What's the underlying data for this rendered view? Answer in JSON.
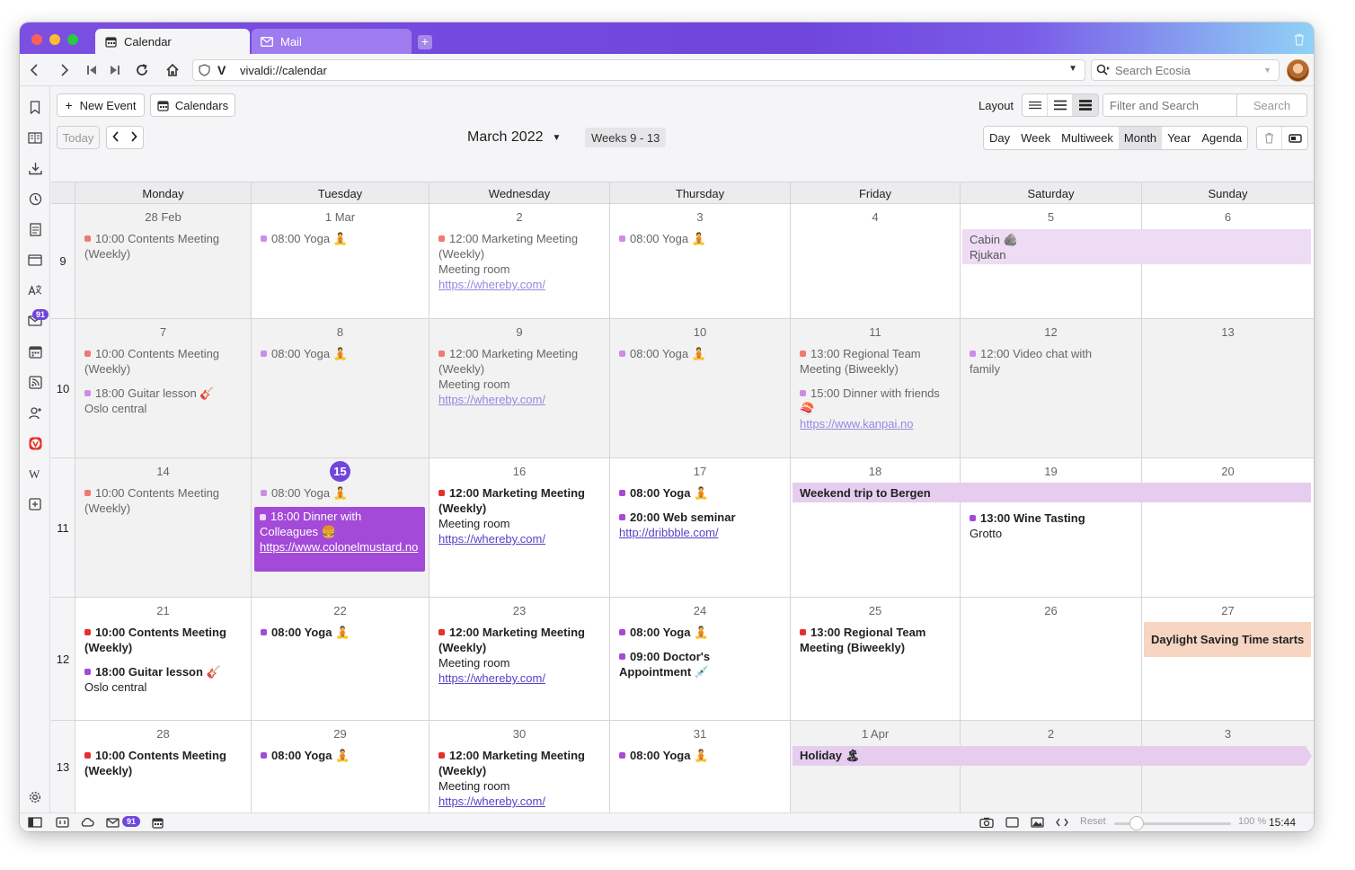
{
  "tabs": [
    {
      "label": "Calendar",
      "icon": "calendar-icon",
      "active": true
    },
    {
      "label": "Mail",
      "icon": "mail-icon",
      "active": false
    }
  ],
  "address": {
    "url": "vivaldi://calendar",
    "search_placeholder": "Search Ecosia"
  },
  "toolbar": {
    "new_event": "New Event",
    "calendars": "Calendars",
    "today": "Today",
    "layout_label": "Layout",
    "filter_placeholder": "Filter and Search",
    "search_button": "Search",
    "title": "March 2022",
    "weeks": "Weeks 9 - 13",
    "views": [
      "Day",
      "Week",
      "Multiweek",
      "Month",
      "Year",
      "Agenda"
    ],
    "active_view": "Month"
  },
  "weekdays": [
    "Monday",
    "Tuesday",
    "Wednesday",
    "Thursday",
    "Friday",
    "Saturday",
    "Sunday"
  ],
  "week_numbers": [
    "9",
    "10",
    "11",
    "12",
    "13"
  ],
  "days": [
    [
      "28 Feb",
      "1 Mar",
      "2",
      "3",
      "4",
      "5",
      "6"
    ],
    [
      "7",
      "8",
      "9",
      "10",
      "11",
      "12",
      "13"
    ],
    [
      "14",
      "15",
      "16",
      "17",
      "18",
      "19",
      "20"
    ],
    [
      "21",
      "22",
      "23",
      "24",
      "25",
      "26",
      "27"
    ],
    [
      "28",
      "29",
      "30",
      "31",
      "1 Apr",
      "2",
      "3"
    ]
  ],
  "events": {
    "w9_mon": {
      "title": "10:00 Contents Meeting (Weekly)"
    },
    "w9_tue": {
      "title": "08:00 Yoga 🧘"
    },
    "w9_wed": {
      "title": "12:00 Marketing Meeting (Weekly)",
      "location": "Meeting room",
      "link": "https://whereby.com/"
    },
    "w9_thu": {
      "title": "08:00 Yoga 🧘"
    },
    "w9_sat": {
      "title": "Cabin 🪨",
      "location": "Rjukan"
    },
    "w10_mon_1": {
      "title": "10:00 Contents Meeting (Weekly)"
    },
    "w10_mon_2": {
      "title": "18:00 Guitar lesson 🎸",
      "location": "Oslo central"
    },
    "w10_tue": {
      "title": "08:00 Yoga 🧘"
    },
    "w10_wed": {
      "title": "12:00 Marketing Meeting (Weekly)",
      "location": "Meeting room",
      "link": "https://whereby.com/"
    },
    "w10_thu": {
      "title": "08:00 Yoga 🧘"
    },
    "w10_fri_1": {
      "title": "13:00 Regional Team Meeting (Biweekly)"
    },
    "w10_fri_2": {
      "title": "15:00 Dinner with friends 🍣",
      "link": "https://www.kanpai.no"
    },
    "w10_sat": {
      "title": "12:00 Video chat with family"
    },
    "w11_mon": {
      "title": "10:00 Contents Meeting (Weekly)"
    },
    "w11_tue_1": {
      "title": "08:00 Yoga 🧘"
    },
    "w11_tue_2": {
      "title": "18:00 Dinner with Colleagues 🍔",
      "link": "https://www.colonelmustard.no"
    },
    "w11_wed": {
      "title": "12:00 Marketing Meeting (Weekly)",
      "location": "Meeting room",
      "link": "https://whereby.com/"
    },
    "w11_thu_1": {
      "title": "08:00 Yoga 🧘"
    },
    "w11_thu_2": {
      "title": "20:00 Web seminar",
      "link": "http://dribbble.com/"
    },
    "w11_fri": {
      "title": "Weekend trip to Bergen"
    },
    "w11_sat": {
      "title": "13:00 Wine Tasting",
      "location": "Grotto"
    },
    "w12_mon_1": {
      "title": "10:00 Contents Meeting (Weekly)"
    },
    "w12_mon_2": {
      "title": "18:00 Guitar lesson 🎸",
      "location": "Oslo central"
    },
    "w12_tue": {
      "title": "08:00 Yoga 🧘"
    },
    "w12_wed": {
      "title": "12:00 Marketing Meeting (Weekly)",
      "location": "Meeting room",
      "link": "https://whereby.com/"
    },
    "w12_thu_1": {
      "title": "08:00 Yoga 🧘"
    },
    "w12_thu_2": {
      "title": "09:00 Doctor's Appointment 💉"
    },
    "w12_fri": {
      "title": "13:00 Regional Team Meeting (Biweekly)"
    },
    "w12_sun": {
      "title": "Daylight Saving Time starts"
    },
    "w13_mon": {
      "title": "10:00 Contents Meeting (Weekly)"
    },
    "w13_tue": {
      "title": "08:00 Yoga 🧘"
    },
    "w13_wed": {
      "title": "12:00 Marketing Meeting (Weekly)",
      "location": "Meeting room",
      "link": "https://whereby.com/"
    },
    "w13_thu": {
      "title": "08:00 Yoga 🧘"
    },
    "w13_fri": {
      "title": "Holiday 🏝"
    }
  },
  "sidebar_badge": "91",
  "status": {
    "mail_badge": "91",
    "reset": "Reset",
    "zoom": "100 %",
    "clock": "15:44"
  },
  "colors": {
    "accent": "#6f45dc",
    "event_red": "#e4322b",
    "event_purple": "#a34ad8",
    "banner": "#e6cdf0",
    "dst_banner": "#f6d5c2"
  }
}
